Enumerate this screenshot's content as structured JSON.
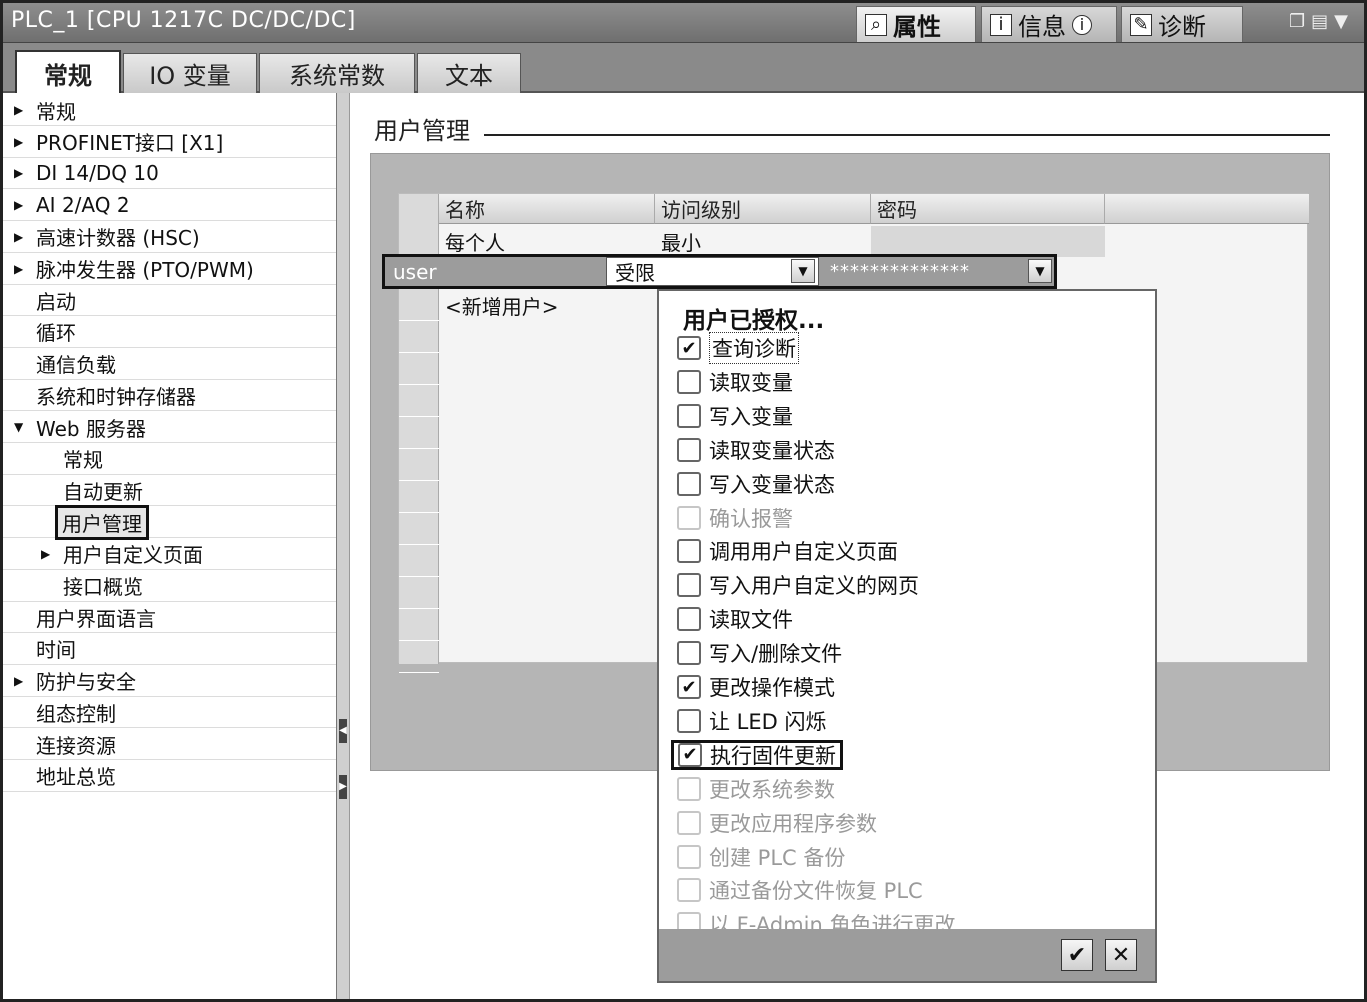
{
  "window": {
    "title": "PLC_1 [CPU 1217C DC/DC/DC]",
    "panels": [
      {
        "label": "属性",
        "icon": "magnifier-icon"
      },
      {
        "label": "信息",
        "icon": "info-icon"
      },
      {
        "label": "诊断",
        "icon": "diagnostics-icon"
      }
    ]
  },
  "tabs": [
    "常规",
    "IO 变量",
    "系统常数",
    "文本"
  ],
  "tree": [
    {
      "label": "常规",
      "arrow": "right",
      "indent": 0
    },
    {
      "label": "PROFINET接口 [X1]",
      "arrow": "right",
      "indent": 0
    },
    {
      "label": "DI 14/DQ 10",
      "arrow": "right",
      "indent": 0
    },
    {
      "label": "AI 2/AQ 2",
      "arrow": "right",
      "indent": 0
    },
    {
      "label": "高速计数器 (HSC)",
      "arrow": "right",
      "indent": 0
    },
    {
      "label": "脉冲发生器 (PTO/PWM)",
      "arrow": "right",
      "indent": 0
    },
    {
      "label": "启动",
      "arrow": "",
      "indent": 0
    },
    {
      "label": "循环",
      "arrow": "",
      "indent": 0
    },
    {
      "label": "通信负载",
      "arrow": "",
      "indent": 0
    },
    {
      "label": "系统和时钟存储器",
      "arrow": "",
      "indent": 0
    },
    {
      "label": "Web 服务器",
      "arrow": "down",
      "indent": 0
    },
    {
      "label": "常规",
      "arrow": "",
      "indent": 1
    },
    {
      "label": "自动更新",
      "arrow": "",
      "indent": 1
    },
    {
      "label": "用户管理",
      "arrow": "",
      "indent": 1,
      "selected": true
    },
    {
      "label": "用户自定义页面",
      "arrow": "right",
      "indent": 1
    },
    {
      "label": "接口概览",
      "arrow": "",
      "indent": 1
    },
    {
      "label": "用户界面语言",
      "arrow": "",
      "indent": 0
    },
    {
      "label": "时间",
      "arrow": "",
      "indent": 0
    },
    {
      "label": "防护与安全",
      "arrow": "right",
      "indent": 0
    },
    {
      "label": "组态控制",
      "arrow": "",
      "indent": 0
    },
    {
      "label": "连接资源",
      "arrow": "",
      "indent": 0
    },
    {
      "label": "地址总览",
      "arrow": "",
      "indent": 0
    }
  ],
  "section": {
    "title": "用户管理"
  },
  "table": {
    "headers": [
      "名称",
      "访问级别",
      "密码"
    ],
    "rows": [
      {
        "name": "每个人",
        "level": "最小",
        "password": ""
      },
      {
        "name": "user",
        "level": "受限",
        "password": "**************"
      },
      {
        "name": "<新增用户>",
        "level": "",
        "password": ""
      }
    ]
  },
  "dropdown": {
    "title": "用户已授权...",
    "options": [
      {
        "label": "查询诊断",
        "checked": true,
        "enabled": true,
        "focus": true
      },
      {
        "label": "读取变量",
        "checked": false,
        "enabled": true
      },
      {
        "label": "写入变量",
        "checked": false,
        "enabled": true
      },
      {
        "label": "读取变量状态",
        "checked": false,
        "enabled": true
      },
      {
        "label": "写入变量状态",
        "checked": false,
        "enabled": true
      },
      {
        "label": "确认报警",
        "checked": false,
        "enabled": false
      },
      {
        "label": "调用用户自定义页面",
        "checked": false,
        "enabled": true
      },
      {
        "label": "写入用户自定义的网页",
        "checked": false,
        "enabled": true
      },
      {
        "label": "读取文件",
        "checked": false,
        "enabled": true
      },
      {
        "label": "写入/删除文件",
        "checked": false,
        "enabled": true
      },
      {
        "label": "更改操作模式",
        "checked": true,
        "enabled": true
      },
      {
        "label": "让 LED 闪烁",
        "checked": false,
        "enabled": true
      },
      {
        "label": "执行固件更新",
        "checked": true,
        "enabled": true,
        "boxed": true
      },
      {
        "label": "更改系统参数",
        "checked": false,
        "enabled": false
      },
      {
        "label": "更改应用程序参数",
        "checked": false,
        "enabled": false
      },
      {
        "label": "创建 PLC 备份",
        "checked": false,
        "enabled": false
      },
      {
        "label": "通过备份文件恢复 PLC",
        "checked": false,
        "enabled": false
      },
      {
        "label": "以 F-Admin 角色进行更改",
        "checked": false,
        "enabled": false
      }
    ],
    "ok_icon": "checkmark-icon",
    "cancel_icon": "close-icon"
  }
}
